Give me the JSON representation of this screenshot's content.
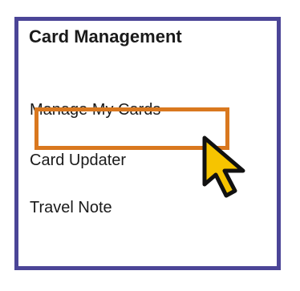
{
  "panel": {
    "title": "Card Management",
    "items": [
      {
        "label": "Manage My Cards",
        "highlighted": true
      },
      {
        "label": "Card Updater"
      },
      {
        "label": "Travel Note"
      }
    ]
  },
  "colors": {
    "panel_border": "#4b4597",
    "highlight_border": "#d9781f",
    "cursor_fill": "#f6c400",
    "cursor_outline": "#111111",
    "text": "#1a1a1a"
  },
  "icons": {
    "cursor": "pointer-arrow-icon"
  }
}
